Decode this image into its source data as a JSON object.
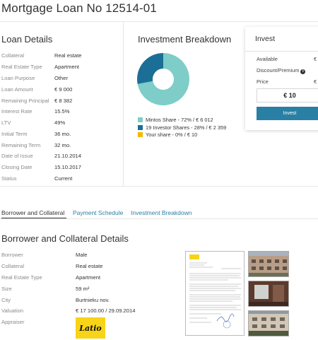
{
  "page": {
    "title": "Mortgage Loan No 12514-01"
  },
  "loan_details": {
    "title": "Loan Details",
    "rows": [
      {
        "label": "Collateral",
        "value": "Real estate"
      },
      {
        "label": "Real Estate Type",
        "value": "Apartment"
      },
      {
        "label": "Loan Purpose",
        "value": "Other"
      },
      {
        "label": "Loan Amount",
        "value": "€ 9 000"
      },
      {
        "label": "Remaining Principal",
        "value": "€ 8 382"
      },
      {
        "label": "Interest Rate",
        "value": "15.5%"
      },
      {
        "label": "LTV",
        "value": "49%"
      },
      {
        "label": "Initial Term",
        "value": "36 mo."
      },
      {
        "label": "Remaining Term",
        "value": "32 mo."
      },
      {
        "label": "Date of Issue",
        "value": "21.10.2014"
      },
      {
        "label": "Closing Date",
        "value": "15.10.2017"
      },
      {
        "label": "Status",
        "value": "Current"
      }
    ]
  },
  "investment_breakdown": {
    "title": "Investment Breakdown",
    "legend": [
      {
        "label": "Mintos Share - 72% / € 6 012",
        "color": "#7ecdc8"
      },
      {
        "label": "19 Investor Shares - 28% / € 2 359",
        "color": "#1b6f97"
      },
      {
        "label": "Your share - 0% / € 10",
        "color": "#f5b800"
      }
    ]
  },
  "chart_data": {
    "type": "pie",
    "series": [
      {
        "name": "Mintos Share",
        "value": 72,
        "amount": 6012,
        "color": "#7ecdc8"
      },
      {
        "name": "19 Investor Shares",
        "value": 28,
        "amount": 2359,
        "color": "#1b6f97"
      },
      {
        "name": "Your share",
        "value": 0,
        "amount": 10,
        "color": "#f5b800"
      }
    ]
  },
  "invest": {
    "title": "Invest",
    "rows": [
      {
        "label": "Available",
        "value": "€"
      },
      {
        "label": "Discount/Premium",
        "value": ""
      },
      {
        "label": "Price",
        "value": "€"
      }
    ],
    "amount": "€ 10",
    "button_label": "Invest"
  },
  "tabs": [
    {
      "label": "Borrower and Collateral"
    },
    {
      "label": "Payment Schedule"
    },
    {
      "label": "Investment Breakdown"
    }
  ],
  "borrower": {
    "title": "Borrower and Collateral Details",
    "rows": [
      {
        "label": "Borrower",
        "value": "Male"
      },
      {
        "label": "Collateral",
        "value": "Real estate"
      },
      {
        "label": "Real Estate Type",
        "value": "Apartment"
      },
      {
        "label": "Size",
        "value": "59 m²"
      },
      {
        "label": "City",
        "value": "Burtnieku nov."
      },
      {
        "label": "Valuation",
        "value": "€ 17 100.00 / 29.09.2014"
      },
      {
        "label": "Appraiser",
        "value": ""
      }
    ],
    "appraiser_logo_text": "Latio"
  }
}
